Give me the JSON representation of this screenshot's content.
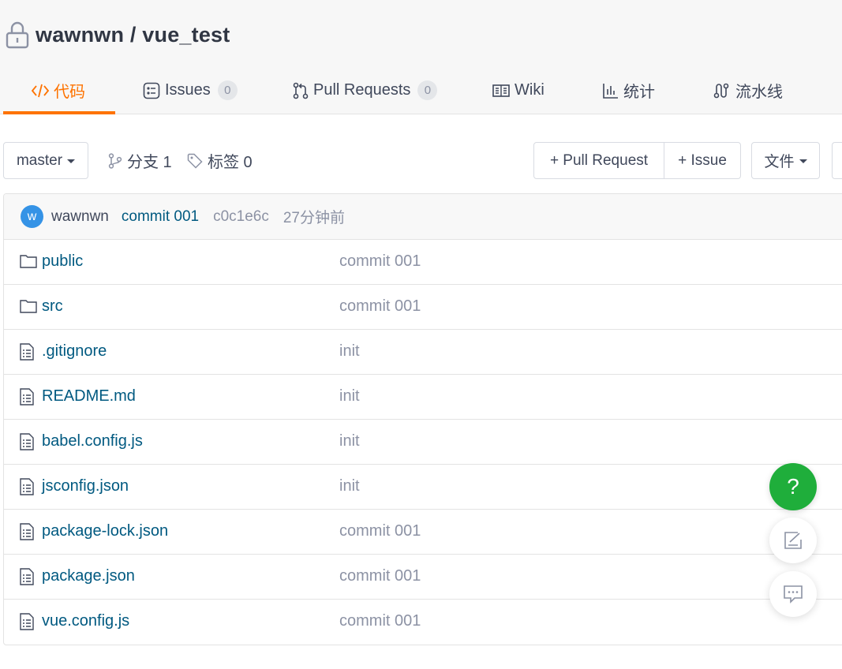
{
  "repo": {
    "owner_and_name": "wawnwn / vue_test"
  },
  "tabs": [
    {
      "label": "代码",
      "icon": "code-icon"
    },
    {
      "label": "Issues",
      "badge": "0",
      "icon": "issues-icon"
    },
    {
      "label": "Pull Requests",
      "badge": "0",
      "icon": "pull-request-icon"
    },
    {
      "label": "Wiki",
      "icon": "book-icon"
    },
    {
      "label": "统计",
      "icon": "bar-chart-icon"
    },
    {
      "label": "流水线",
      "icon": "pipeline-icon"
    }
  ],
  "toolbar": {
    "branch": "master",
    "branches_label": "分支 1",
    "tags_label": "标签 0",
    "pull_request_button": "+ Pull Request",
    "issue_button": "+ Issue",
    "file_menu": "文件"
  },
  "commit": {
    "avatar_initial": "w",
    "author": "wawnwn",
    "message": "commit 001",
    "sha": "c0c1e6c",
    "time": "27分钟前"
  },
  "files": [
    {
      "name": "public",
      "type": "folder",
      "commit": "commit 001"
    },
    {
      "name": "src",
      "type": "folder",
      "commit": "commit 001"
    },
    {
      "name": ".gitignore",
      "type": "file",
      "commit": "init"
    },
    {
      "name": "README.md",
      "type": "file",
      "commit": "init"
    },
    {
      "name": "babel.config.js",
      "type": "file",
      "commit": "init"
    },
    {
      "name": "jsconfig.json",
      "type": "file",
      "commit": "init"
    },
    {
      "name": "package-lock.json",
      "type": "file",
      "commit": "commit 001"
    },
    {
      "name": "package.json",
      "type": "file",
      "commit": "commit 001"
    },
    {
      "name": "vue.config.js",
      "type": "file",
      "commit": "commit 001"
    }
  ],
  "floating": {
    "help": "?"
  },
  "colors": {
    "accent": "#fe7300",
    "link": "#005980",
    "help_green": "#1fae3b",
    "avatar_blue": "#3593e6"
  }
}
